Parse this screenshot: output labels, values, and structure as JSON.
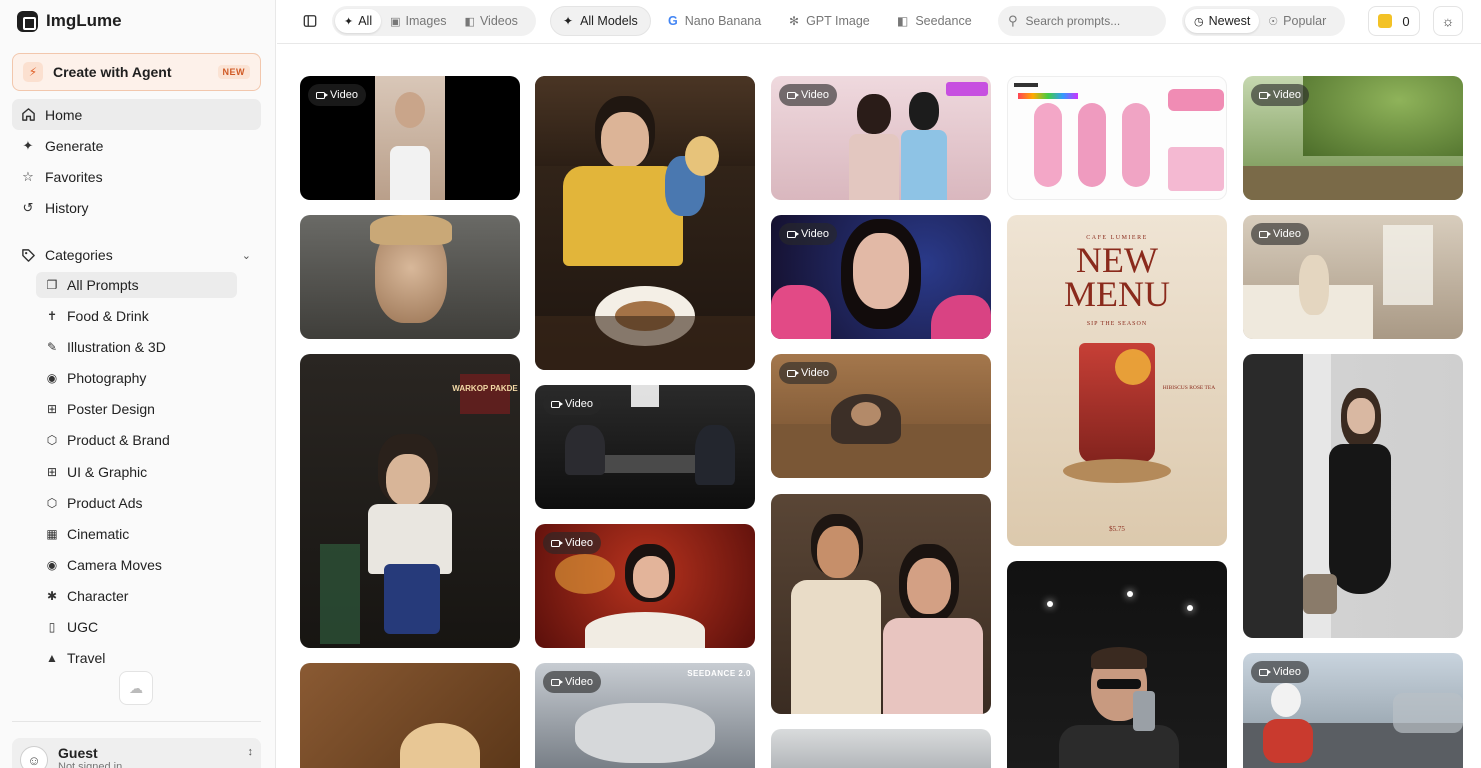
{
  "brand": {
    "name": "ImgLume",
    "icon": "imglume-logo-icon"
  },
  "agent": {
    "label": "Create with Agent",
    "badge": "NEW",
    "icon": "bolt-icon"
  },
  "nav": [
    {
      "label": "Home",
      "icon": "home-icon",
      "active": true
    },
    {
      "label": "Generate",
      "icon": "sparkle-icon",
      "active": false
    },
    {
      "label": "Favorites",
      "icon": "star-icon",
      "active": false
    },
    {
      "label": "History",
      "icon": "history-icon",
      "active": false
    }
  ],
  "categories": {
    "title": "Categories",
    "items": [
      {
        "label": "All Prompts",
        "icon": "layers-icon",
        "active": true
      },
      {
        "label": "Food & Drink",
        "icon": "utensils-icon"
      },
      {
        "label": "Illustration & 3D",
        "icon": "brush-icon"
      },
      {
        "label": "Photography",
        "icon": "camera-icon"
      },
      {
        "label": "Poster Design",
        "icon": "layout-icon"
      },
      {
        "label": "Product & Brand",
        "icon": "box-icon"
      },
      {
        "label": "UI & Graphic",
        "icon": "grid-icon"
      },
      {
        "label": "Product Ads",
        "icon": "package-icon"
      },
      {
        "label": "Cinematic",
        "icon": "film-icon"
      },
      {
        "label": "Camera Moves",
        "icon": "camera-move-icon"
      },
      {
        "label": "Character",
        "icon": "person-icon"
      },
      {
        "label": "UGC",
        "icon": "phone-icon"
      },
      {
        "label": "Travel",
        "icon": "plane-icon"
      }
    ]
  },
  "user": {
    "name": "Guest",
    "sub": "Not signed in"
  },
  "topbar": {
    "media_filters": [
      {
        "label": "All",
        "icon": "sparkle-icon",
        "active": true
      },
      {
        "label": "Images",
        "icon": "image-icon",
        "active": false
      },
      {
        "label": "Videos",
        "icon": "video-icon",
        "active": false
      }
    ],
    "models": [
      {
        "label": "All Models",
        "icon": "sparkle-icon",
        "active": true
      },
      {
        "label": "Nano Banana",
        "icon": "google-icon",
        "active": false
      },
      {
        "label": "GPT Image",
        "icon": "openai-icon",
        "active": false
      },
      {
        "label": "Seedance",
        "icon": "video-icon",
        "active": false
      }
    ],
    "search_placeholder": "Search prompts...",
    "sort": [
      {
        "label": "Newest",
        "icon": "clock-icon",
        "active": true
      },
      {
        "label": "Popular",
        "icon": "flame-icon",
        "active": false
      }
    ],
    "credits": "0"
  },
  "video_badge_label": "Video",
  "card_texts": {
    "menu_title_1": "NEW",
    "menu_title_2": "MENU",
    "menu_cafe": "CAFE LUMIERE",
    "menu_sub": "SIP THE SEASON",
    "menu_tea": "HIBISCUS ROSE TEA",
    "menu_price": "$5.75",
    "seedance_tag": "SEEDANCE 2.0",
    "warkop": "WARKOP PAKDE"
  }
}
